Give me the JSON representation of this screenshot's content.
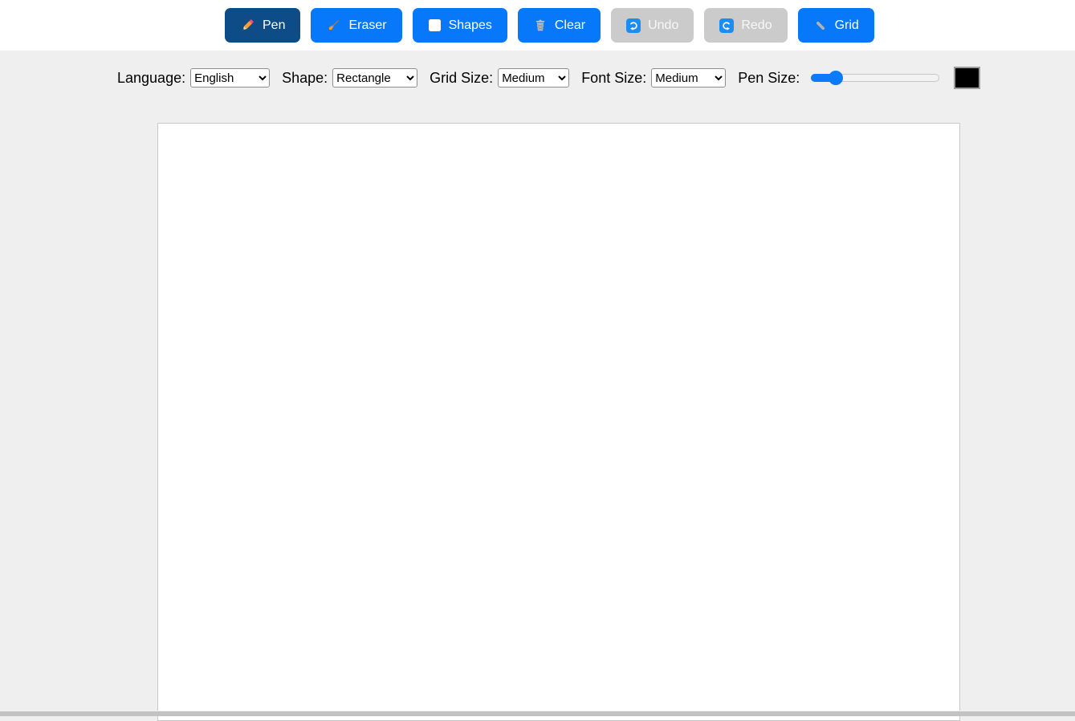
{
  "toolbar": {
    "buttons": [
      {
        "label": "Pen",
        "icon": "pencil-icon",
        "state": "active"
      },
      {
        "label": "Eraser",
        "icon": "brush-icon",
        "state": "default"
      },
      {
        "label": "Shapes",
        "icon": "square-icon",
        "state": "default"
      },
      {
        "label": "Clear",
        "icon": "wastebasket-icon",
        "state": "default"
      },
      {
        "label": "Undo",
        "icon": "undo-arrow-icon",
        "state": "disabled"
      },
      {
        "label": "Redo",
        "icon": "redo-arrow-icon",
        "state": "disabled"
      },
      {
        "label": "Grid",
        "icon": "grid-pencil-icon",
        "state": "default"
      }
    ]
  },
  "controls": {
    "language": {
      "label": "Language:",
      "value": "English"
    },
    "shape": {
      "label": "Shape:",
      "value": "Rectangle"
    },
    "grid_size": {
      "label": "Grid Size:",
      "value": "Medium"
    },
    "font_size": {
      "label": "Font Size:",
      "value": "Medium"
    },
    "pen_size": {
      "label": "Pen Size:",
      "percent": 19
    },
    "color": {
      "value": "#000000"
    }
  },
  "colors": {
    "primary_blue": "#0778f9",
    "active_button_blue": "#0d4c86",
    "disabled_gray": "#cbcbcb",
    "icon_square_blue": "#1b8cf2",
    "page_background": "#efefef",
    "canvas_background": "#ffffff"
  }
}
